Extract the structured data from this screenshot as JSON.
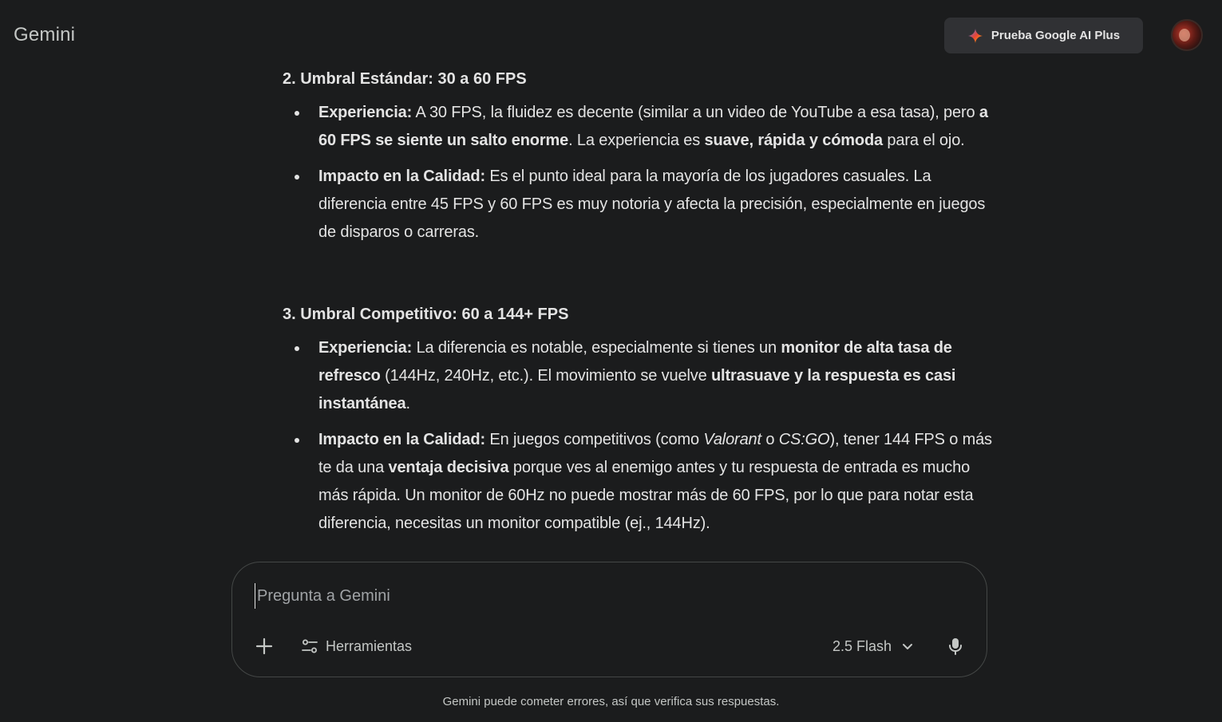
{
  "header": {
    "logo": "Gemini",
    "upgrade_label": "Prueba Google AI Plus"
  },
  "content": {
    "sections": [
      {
        "heading": "2. Umbral Estándar: 30 a 60 FPS",
        "items": [
          {
            "segments": [
              {
                "text": "Experiencia:",
                "bold": true
              },
              {
                "text": " A 30 FPS, la fluidez es decente (similar a un video de YouTube a esa tasa), pero ",
                "bold": false
              },
              {
                "text": "a 60 FPS se siente un salto enorme",
                "bold": true
              },
              {
                "text": ". La experiencia es ",
                "bold": false
              },
              {
                "text": "suave, rápida y cómoda",
                "bold": true
              },
              {
                "text": " para el ojo.",
                "bold": false
              }
            ]
          },
          {
            "segments": [
              {
                "text": "Impacto en la Calidad:",
                "bold": true
              },
              {
                "text": " Es el punto ideal para la mayoría de los jugadores casuales. La diferencia entre 45 FPS y 60 FPS es muy notoria y afecta la precisión, especialmente en juegos de disparos o carreras.",
                "bold": false
              }
            ]
          }
        ]
      },
      {
        "heading": "3. Umbral Competitivo: 60 a 144+ FPS",
        "items": [
          {
            "segments": [
              {
                "text": "Experiencia:",
                "bold": true
              },
              {
                "text": " La diferencia es notable, especialmente si tienes un ",
                "bold": false
              },
              {
                "text": "monitor de alta tasa de refresco",
                "bold": true
              },
              {
                "text": " (144Hz, 240Hz, etc.). El movimiento se vuelve ",
                "bold": false
              },
              {
                "text": "ultrasuave y la respuesta es casi instantánea",
                "bold": true
              },
              {
                "text": ".",
                "bold": false
              }
            ]
          },
          {
            "segments": [
              {
                "text": "Impacto en la Calidad:",
                "bold": true
              },
              {
                "text": " En juegos competitivos (como ",
                "bold": false
              },
              {
                "text": "Valorant",
                "bold": false,
                "italic": true
              },
              {
                "text": " o ",
                "bold": false
              },
              {
                "text": "CS:GO",
                "bold": false,
                "italic": true
              },
              {
                "text": "), tener 144 FPS o más te da una ",
                "bold": false
              },
              {
                "text": "ventaja decisiva",
                "bold": true
              },
              {
                "text": " porque ves al enemigo antes y tu respuesta de entrada es mucho más rápida. Un monitor de 60Hz no puede mostrar más de 60 FPS, por lo que para notar esta diferencia, necesitas un monitor compatible (ej., 144Hz).",
                "bold": false
              }
            ]
          }
        ]
      }
    ]
  },
  "composer": {
    "placeholder": "Pregunta a Gemini",
    "tools_label": "Herramientas",
    "model_label": "2.5 Flash"
  },
  "footer": {
    "disclaimer": "Gemini puede cometer errores, así que verifica sus respuestas."
  },
  "icons": {
    "upgrade": "sparkle-icon",
    "add": "plus-icon",
    "tools": "tools-sliders-icon",
    "model_dropdown": "chevron-down-icon",
    "mic": "microphone-icon"
  }
}
